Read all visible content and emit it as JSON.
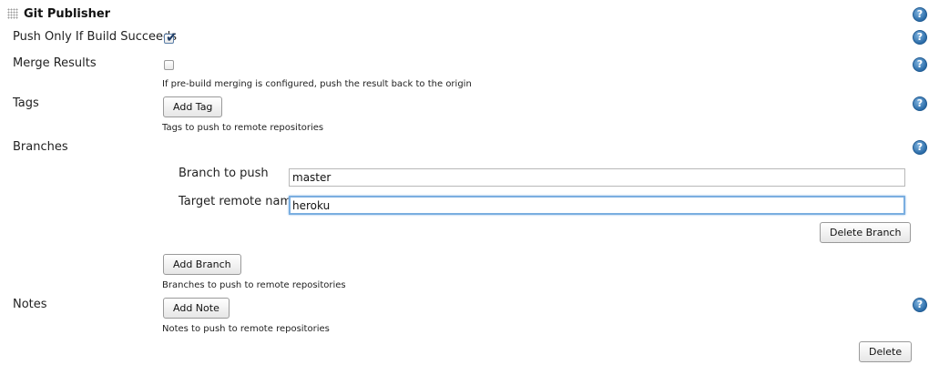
{
  "section": {
    "title": "Git Publisher"
  },
  "push_only": {
    "label": "Push Only If Build Succeeds",
    "checked": true
  },
  "merge_results": {
    "label": "Merge Results",
    "checked": false,
    "description": "If pre-build merging is configured, push the result back to the origin"
  },
  "tags": {
    "label": "Tags",
    "add_button": "Add Tag",
    "description": "Tags to push to remote repositories"
  },
  "branches": {
    "label": "Branches",
    "branch_to_push_label": "Branch to push",
    "branch_to_push_value": "master",
    "target_remote_label": "Target remote name",
    "target_remote_value": "heroku",
    "delete_branch_button": "Delete Branch",
    "add_button": "Add Branch",
    "description": "Branches to push to remote repositories"
  },
  "notes": {
    "label": "Notes",
    "add_button": "Add Note",
    "description": "Notes to push to remote repositories"
  },
  "delete_button": "Delete",
  "help_glyph": "?"
}
